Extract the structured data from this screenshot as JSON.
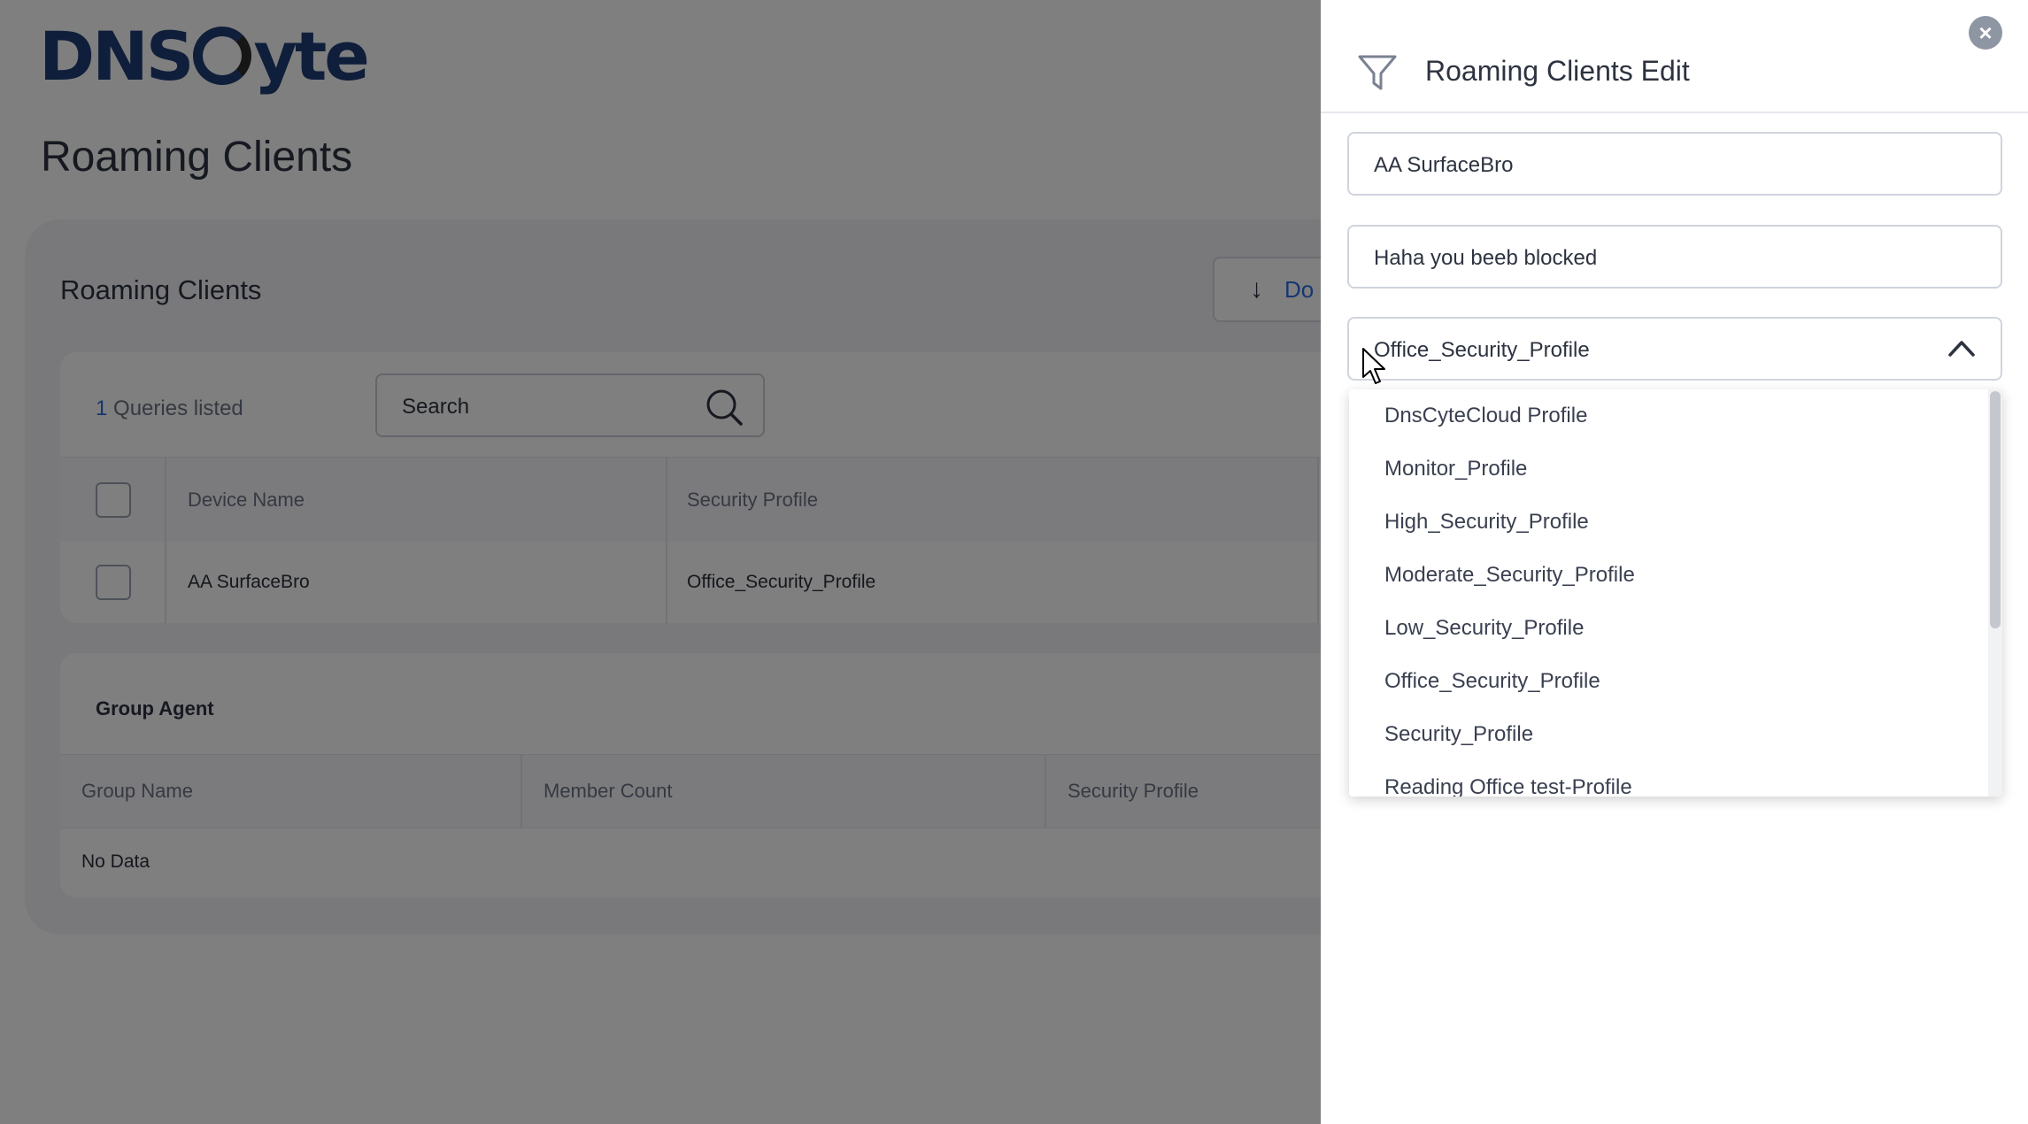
{
  "app": {
    "logo": "DNSCyte",
    "page_title": "Roaming Clients"
  },
  "card": {
    "title": "Roaming Clients",
    "download_label": "Do",
    "queries_count": "1",
    "queries_label": "Queries listed",
    "search_placeholder": "Search",
    "columns": [
      "Device Name",
      "Security Profile"
    ],
    "rows": [
      {
        "device_name": "AA SurfaceBro",
        "security_profile": "Office_Security_Profile"
      }
    ]
  },
  "group_agent": {
    "title": "Group Agent",
    "columns": [
      "Group Name",
      "Member Count",
      "Security Profile"
    ],
    "empty_text": "No Data"
  },
  "panel": {
    "title": "Roaming Clients Edit",
    "name_value": "AA SurfaceBro",
    "message_value": "Haha you beeb blocked",
    "profile_selected": "Office_Security_Profile",
    "options": [
      "DnsCyteCloud Profile",
      "Monitor_Profile",
      "High_Security_Profile",
      "Moderate_Security_Profile",
      "Low_Security_Profile",
      "Office_Security_Profile",
      "Security_Profile",
      "Reading Office test-Profile"
    ]
  },
  "icons": [
    "close-icon",
    "filter-icon",
    "chevron-up-icon",
    "search-icon",
    "arrow-down-icon"
  ],
  "colors": {
    "brand": "#1f3c75",
    "accent": "#2f6de0",
    "overlay": "rgba(0,0,0,0.5)"
  }
}
